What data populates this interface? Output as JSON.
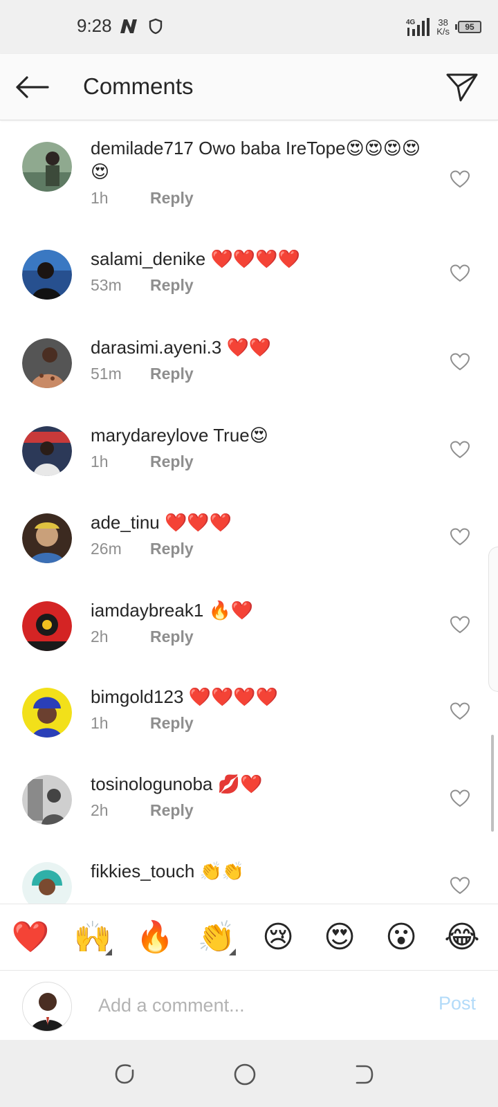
{
  "status_bar": {
    "time": "9:28",
    "network": "4G",
    "speed_value": "38",
    "speed_unit": "K/s",
    "battery": "95",
    "icons": [
      "n-app-icon",
      "shield-icon",
      "signal-icon",
      "battery-icon"
    ]
  },
  "header": {
    "title": "Comments",
    "back_icon": "arrow-left-icon",
    "send_icon": "paper-plane-icon"
  },
  "comments": [
    {
      "username": "demilade717",
      "text": " Owo baba IreTope😍😍😍😍😍",
      "time": "1h",
      "reply": "Reply",
      "avatar_color": "#6f8a74"
    },
    {
      "username": "salami_denike",
      "text": " ❤️❤️❤️❤️",
      "time": "53m",
      "reply": "Reply",
      "avatar_color": "#1f3d7a"
    },
    {
      "username": "darasimi.ayeni.3",
      "text": " ❤️❤️",
      "time": "51m",
      "reply": "Reply",
      "avatar_color": "#6b4b3a"
    },
    {
      "username": "marydareylove",
      "text": " True😍",
      "time": "1h",
      "reply": "Reply",
      "avatar_color": "#3a4a6a"
    },
    {
      "username": "ade_tinu",
      "text": " ❤️❤️❤️",
      "time": "26m",
      "reply": "Reply",
      "avatar_color": "#4a3528"
    },
    {
      "username": "iamdaybreak1",
      "text": " 🔥❤️",
      "time": "2h",
      "reply": "Reply",
      "avatar_color": "#d32020"
    },
    {
      "username": "bimgold123",
      "text": " ❤️❤️❤️❤️",
      "time": "1h",
      "reply": "Reply",
      "avatar_color": "#f2e01a"
    },
    {
      "username": "tosinologunoba",
      "text": " 💋❤️",
      "time": "2h",
      "reply": "Reply",
      "avatar_color": "#8a8a8a"
    },
    {
      "username": "fikkies_touch",
      "text": " 👏👏",
      "time": "",
      "reply": "",
      "avatar_color": "#2fb0a8"
    }
  ],
  "reactions": [
    "❤️",
    "🙌",
    "🔥",
    "👏",
    "😢",
    "😍",
    "😮",
    "😂"
  ],
  "input": {
    "placeholder": "Add a comment...",
    "post_label": "Post"
  },
  "colors": {
    "accent_disabled": "#b3dbf9",
    "secondary_text": "#8e8e8e",
    "primary_text": "#262626"
  }
}
